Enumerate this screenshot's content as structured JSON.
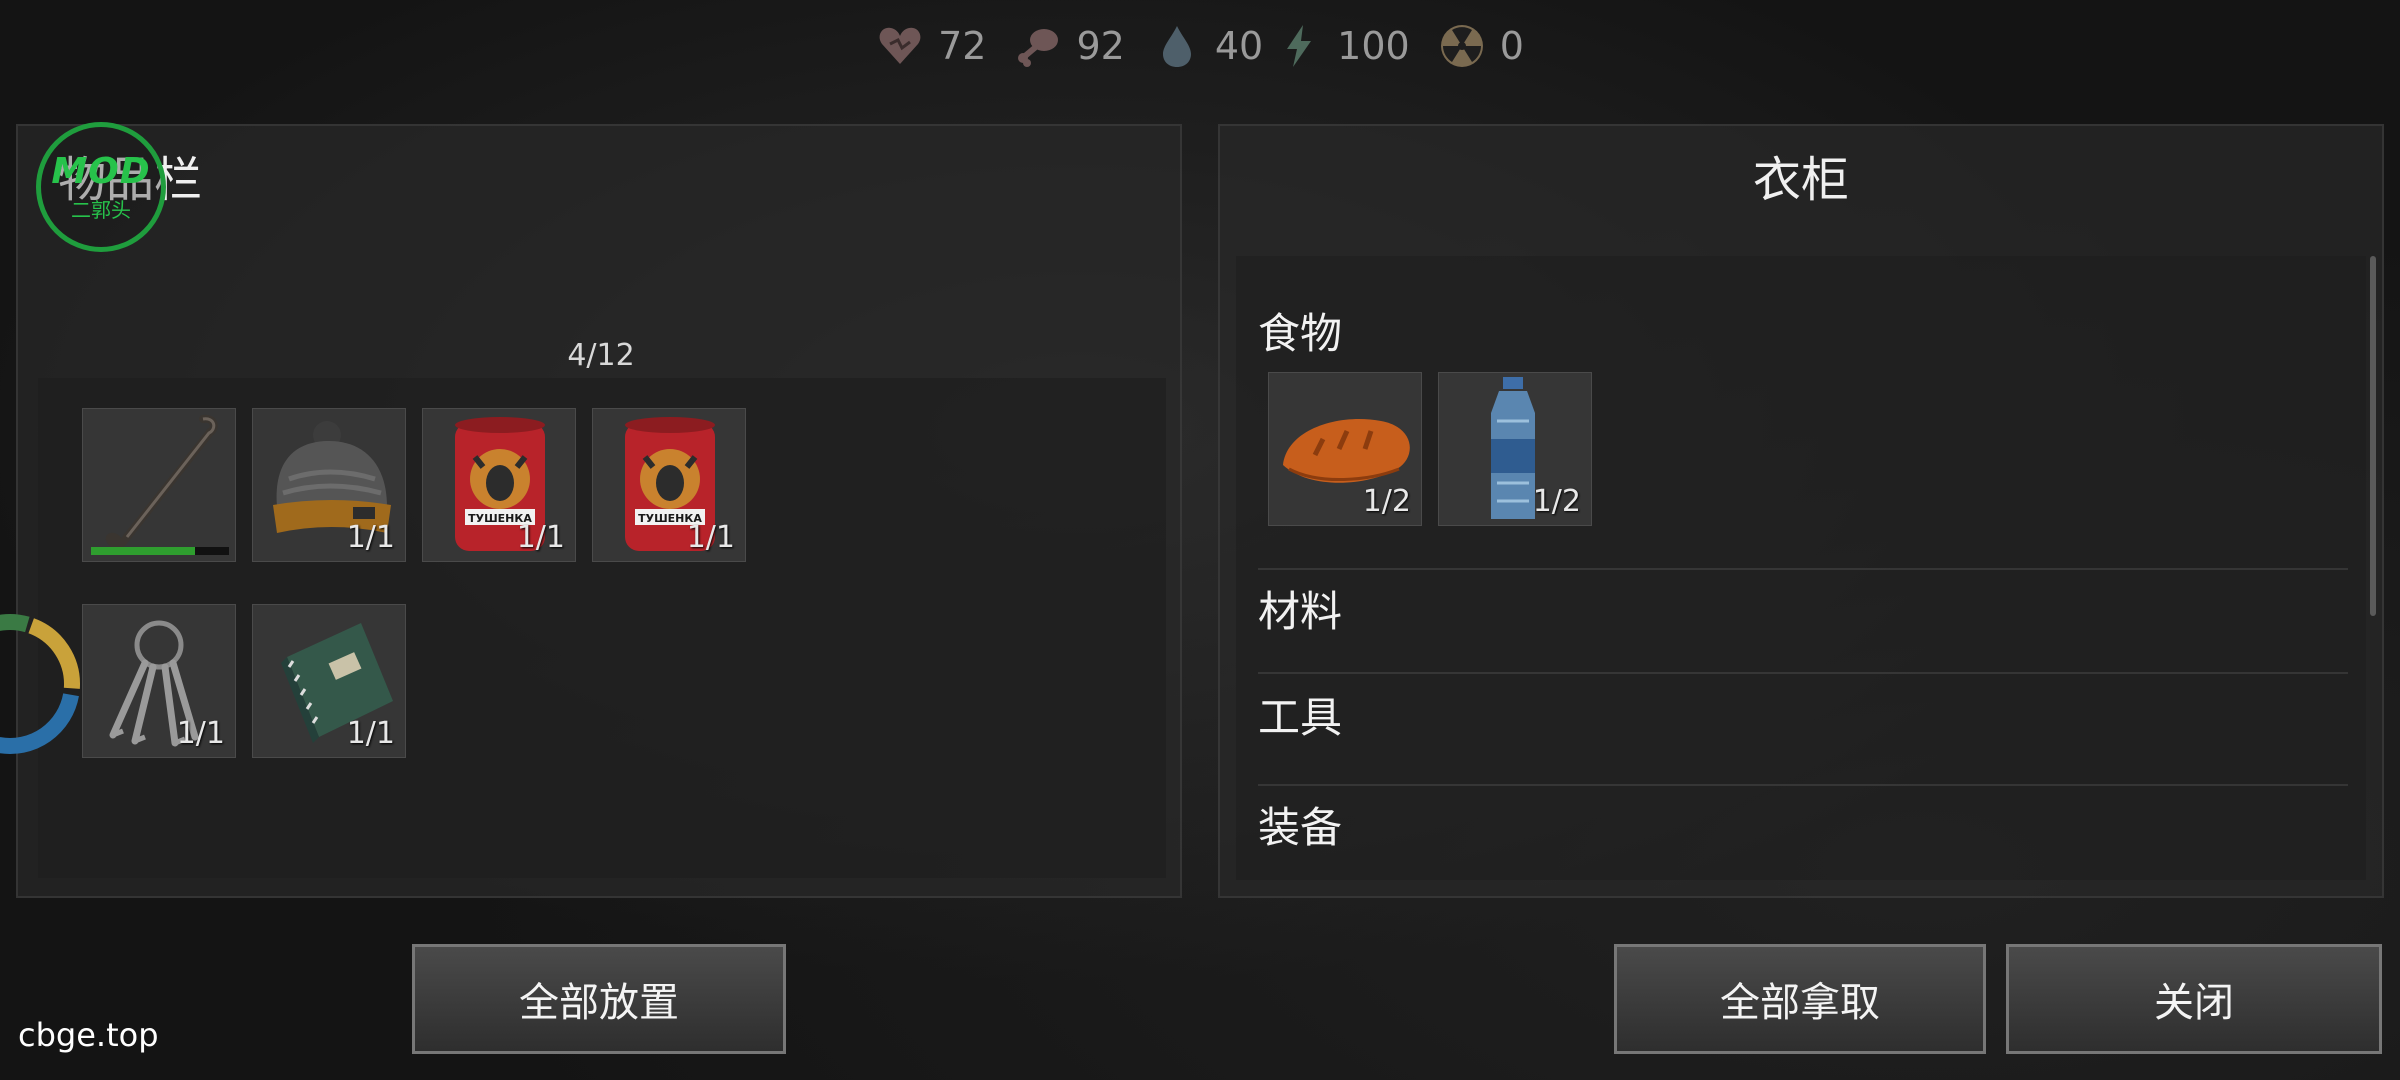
{
  "status": {
    "health": "72",
    "food": "92",
    "water": "40",
    "energy": "100",
    "radiation": "0"
  },
  "left_panel": {
    "title": "物品栏",
    "capacity": "4/12",
    "items": [
      {
        "icon": "crowbar-icon",
        "count": "",
        "durability": 0.75
      },
      {
        "icon": "beanie-hat-icon",
        "count": "1/1"
      },
      {
        "icon": "canned-meat-icon",
        "count": "1/1",
        "can_label": "TУШЕНКА"
      },
      {
        "icon": "canned-meat-icon",
        "count": "1/1",
        "can_label": "TУШЕНКА"
      },
      {
        "icon": "key-ring-icon",
        "count": "1/1"
      },
      {
        "icon": "notebook-icon",
        "count": "1/1"
      }
    ]
  },
  "right_panel": {
    "title": "衣柜",
    "categories": {
      "food": "食物",
      "materials": "材料",
      "tools": "工具",
      "equipment": "装备"
    },
    "food_items": [
      {
        "icon": "bread-icon",
        "count": "1/2"
      },
      {
        "icon": "water-bottle-icon",
        "count": "1/2"
      }
    ]
  },
  "buttons": {
    "place_all": "全部放置",
    "take_all": "全部拿取",
    "close": "关闭"
  },
  "overlay": {
    "logo_main": "MOD",
    "logo_sub": "二郭头",
    "watermark": "cbge.top"
  },
  "colors": {
    "durability": "#2f9e2f",
    "logo_green": "#27c24b",
    "can_red": "#b8232a"
  }
}
